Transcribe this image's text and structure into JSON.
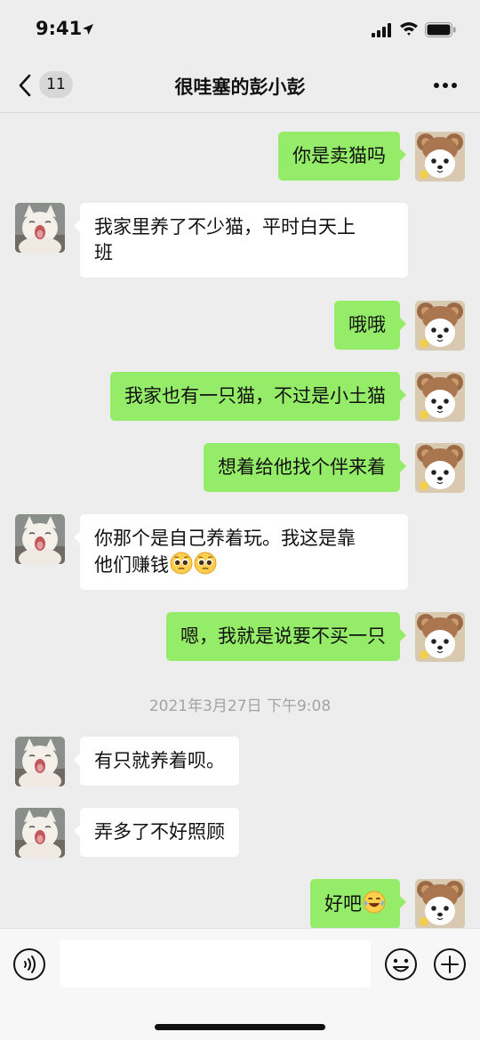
{
  "status_bar": {
    "time": "9:41",
    "icons": [
      "location-arrow-icon",
      "cellular-signal-icon",
      "wifi-icon",
      "battery-icon"
    ]
  },
  "nav": {
    "back_icon": "chevron-left-icon",
    "unread_count": "11",
    "title": "很哇塞的彭小彭",
    "more_icon": "more-dots-icon"
  },
  "avatars": {
    "self": "dog-with-bear-ears-avatar",
    "contact": "yawning-white-cat-avatar"
  },
  "colors": {
    "background": "#ededed",
    "outgoing_bubble": "#95ec69",
    "incoming_bubble": "#ffffff",
    "timestamp_text": "#a3a3a3"
  },
  "messages": [
    {
      "from": "self",
      "text": "你是卖猫吗"
    },
    {
      "from": "contact",
      "text": "我家里养了不少猫，平时白天上",
      "text2": "班"
    },
    {
      "from": "self",
      "text": "哦哦"
    },
    {
      "from": "self",
      "text": "我家也有一只猫，不过是小土猫"
    },
    {
      "from": "self",
      "text": "想着给他找个伴来着"
    },
    {
      "from": "contact",
      "text": "你那个是自己养着玩。我这是靠",
      "text2": "他们赚钱",
      "emojis": [
        "pleading-face-emoji",
        "pleading-face-emoji"
      ]
    },
    {
      "from": "self",
      "text": "嗯，我就是说要不买一只"
    },
    {
      "from": "contact",
      "text": "有只就养着呗。"
    },
    {
      "from": "contact",
      "text": "弄多了不好照顾"
    },
    {
      "from": "self",
      "text": "好吧",
      "emojis": [
        "crying-laughing-emoji"
      ]
    }
  ],
  "timestamp": "2021年3月27日 下午9:08",
  "input_bar": {
    "voice_icon": "voice-icon",
    "placeholder": "",
    "emoji_icon": "emoji-face-icon",
    "plus_icon": "plus-circle-icon"
  }
}
